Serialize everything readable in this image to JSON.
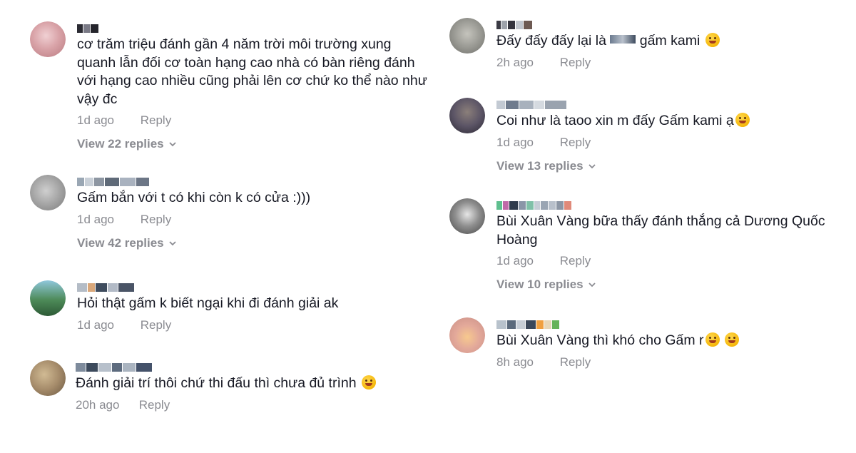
{
  "reply_label": "Reply",
  "left_comments": [
    {
      "text": "cơ trăm triệu đánh gần 4 năm trời môi trường xung quanh lẫn đối cơ toàn hạng cao nhà có bàn riêng đánh với hạng cao nhiều cũng phải lên cơ chứ ko thể nào như vậy đc",
      "date": "1d ago",
      "replies": "View 22 replies",
      "avatar_color": "#d9a3a8",
      "emoji": false
    },
    {
      "text": "Gấm bắn với t có khi còn k có cửa :)))",
      "date": "1d ago",
      "replies": "View 42 replies",
      "avatar_color": "#a4a4a4",
      "emoji": false
    },
    {
      "text": "Hỏi thật gấm k biết ngại khi đi đánh giải ak",
      "date": "1d ago",
      "replies": "",
      "avatar_color": "#4d8a58",
      "emoji": false
    },
    {
      "text": "Đánh giải trí thôi chứ thi đấu thì chưa đủ trình",
      "date": "20h ago",
      "replies": "",
      "avatar_color": "#a58b6a",
      "emoji": true
    }
  ],
  "right_comments": [
    {
      "text": "Đấy đấy đấy lại là",
      "text_after": "gấm kami",
      "date": "2h ago",
      "replies": "",
      "avatar_color": "#9a9a94",
      "emoji": true
    },
    {
      "text": "Coi như là taoo xin m đấy Gấm kami ạ",
      "date": "1d ago",
      "replies": "View 13 replies",
      "avatar_color": "#5c5566",
      "emoji": true
    },
    {
      "text": "Bùi Xuân Vàng bữa thấy đánh thắng cả Dương Quốc Hoàng",
      "date": "1d ago",
      "replies": "View 10 replies",
      "avatar_color": "#7f7f7f",
      "emoji": false
    },
    {
      "text": "Bùi Xuân Vàng thì khó cho Gấm r",
      "date": "8h ago",
      "replies": "",
      "avatar_color": "#e3a99a",
      "emoji": true,
      "emoji_count": 2
    }
  ]
}
